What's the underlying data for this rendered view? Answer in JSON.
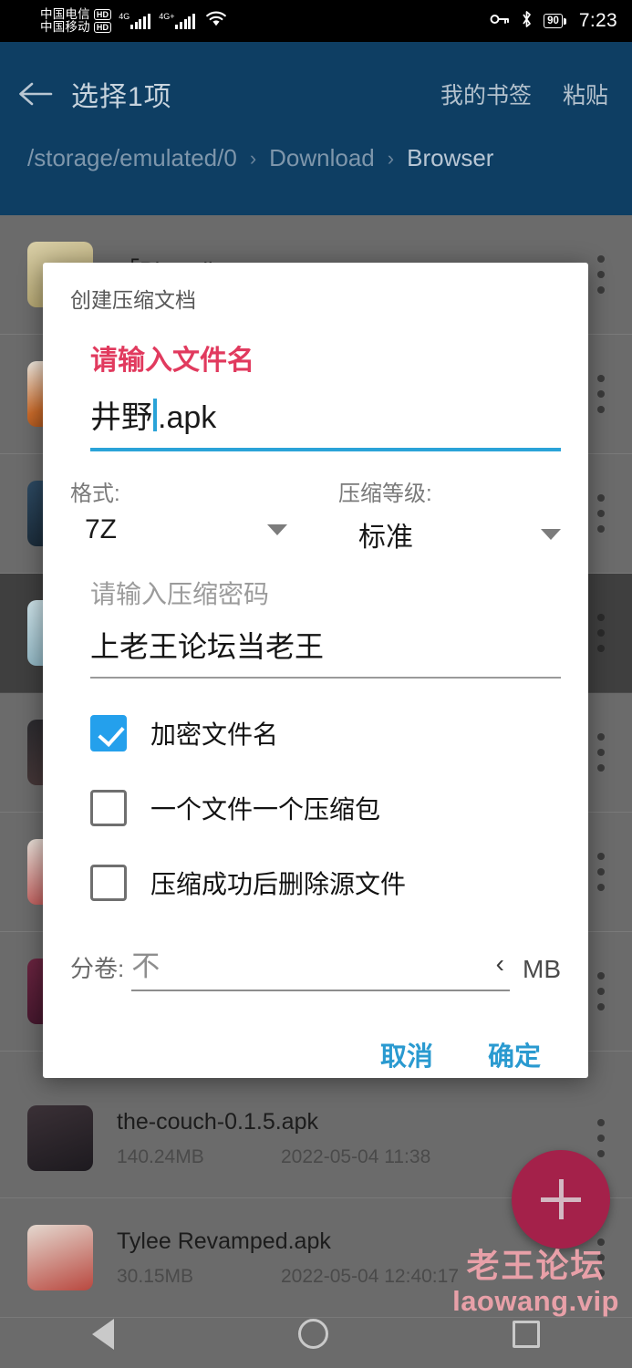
{
  "statusbar": {
    "carrier1": "中国电信",
    "carrier1_badge": "HD",
    "carrier2": "中国移动",
    "carrier2_badge": "HD",
    "net1": "4G",
    "net2": "4G+",
    "battery": "90",
    "time": "7:23",
    "icons": [
      "key-icon",
      "bluetooth-icon",
      "wifi-icon",
      "battery-icon"
    ]
  },
  "header": {
    "back_icon": "back-arrow-icon",
    "title": "选择1项",
    "action_bookmarks": "我的书签",
    "action_paste": "粘贴",
    "breadcrumb": {
      "root": "/storage/emulated/0",
      "sep": "›",
      "mid": "Download",
      "last": "Browser"
    }
  },
  "filelist": {
    "rows": [
      {
        "name": "「Physalis",
        "size": "",
        "date": "",
        "thumb": "th-a",
        "selected": false
      },
      {
        "name": "",
        "size": "",
        "date": "",
        "thumb": "th-b",
        "selected": false
      },
      {
        "name": "",
        "size": "",
        "date": "",
        "thumb": "th-c",
        "selected": false
      },
      {
        "name": "",
        "size": "",
        "date": "",
        "thumb": "th-d",
        "selected": true
      },
      {
        "name": "",
        "size": "",
        "date": "",
        "thumb": "th-e",
        "selected": false
      },
      {
        "name": "",
        "size": "",
        "date": "",
        "thumb": "th-f",
        "selected": false
      },
      {
        "name": "",
        "size": "",
        "date": "",
        "thumb": "th-g",
        "selected": false
      },
      {
        "name": "the-couch-0.1.5.apk",
        "size": "140.24MB",
        "date": "2022-05-04 11:38",
        "thumb": "th-h",
        "selected": false
      },
      {
        "name": "Tylee Revamped.apk",
        "size": "30.15MB",
        "date": "2022-05-04 12:40:17",
        "thumb": "th-i",
        "selected": false
      }
    ],
    "fab_label": "add-icon",
    "overflow_icon": "more-vertical-icon"
  },
  "watermark": {
    "line1": "老王论坛",
    "line2": "laowang.vip"
  },
  "navbar": {
    "back": "nav-back-icon",
    "home": "nav-home-icon",
    "recents": "nav-recents-icon"
  },
  "dialog": {
    "title": "创建压缩文档",
    "filename_required_label": "请输入文件名",
    "filename_value": "井野",
    "filename_ext": ".apk",
    "format_label": "格式:",
    "format_value": "7Z",
    "level_label": "压缩等级:",
    "level_value": "标准",
    "password_placeholder": "请输入压缩密码",
    "password_value": "上老王论坛当老王",
    "checkboxes": [
      {
        "label": "加密文件名",
        "checked": true
      },
      {
        "label": "一个文件一个压缩包",
        "checked": false
      },
      {
        "label": "压缩成功后删除源文件",
        "checked": false
      }
    ],
    "split_label": "分卷:",
    "split_value": "不",
    "split_chevron": "‹",
    "split_unit": "MB",
    "cancel_label": "取消",
    "confirm_label": "确定"
  },
  "colors": {
    "header_blue": "#0e3e63",
    "accent_blue": "#2aa3d8",
    "required_red": "#e13a5e",
    "checkbox_blue": "#24a0ec",
    "fab_pink": "#a4214a",
    "watermark_pink": "#e8a0a8"
  }
}
